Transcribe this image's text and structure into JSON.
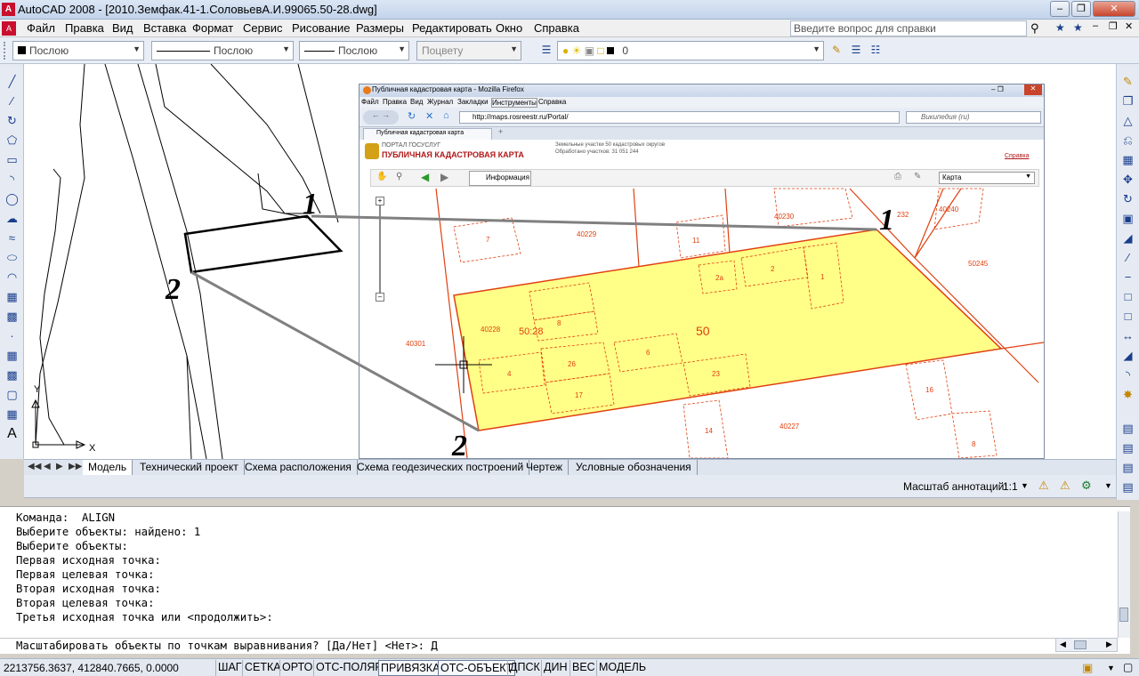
{
  "titlebar": {
    "title": "AutoCAD 2008 - [2010.Земфак.41-1.СоловьевА.И.99065.50-28.dwg]",
    "app_icon": "A"
  },
  "menu": {
    "items": [
      "Файл",
      "Правка",
      "Вид",
      "Вставка",
      "Формат",
      "Сервис",
      "Рисование",
      "Размеры",
      "Редактировать",
      "Окно",
      "Справка"
    ],
    "help_placeholder": "Введите вопрос для справки"
  },
  "toolbar": {
    "color_combo": "Послою",
    "linetype_combo": "Послою",
    "lineweight_combo": "Послою",
    "plotstyle_combo": "Поцвету",
    "layer_combo": "0"
  },
  "drawing": {
    "point_labels": [
      "1",
      "2",
      "1",
      "2"
    ]
  },
  "browser": {
    "title": "Публичная кадастровая карта - Mozilla Firefox",
    "menu": [
      "Файл",
      "Правка",
      "Вид",
      "Журнал",
      "Закладки",
      "Инструменты",
      "Справка"
    ],
    "url": "http://maps.rosreestr.ru/Portal/",
    "search_placeholder": "Википедия (ru)",
    "tab_label": "Публичная кадастровая карта",
    "portal_small": "ПОРТАЛ ГОСУСЛУГ",
    "portal_title": "ПУБЛИЧНАЯ КАДАСТРОВАЯ КАРТА",
    "info_line1": "Земельные участки 50 кадастровых округов",
    "info_line2": "Обработано участков: 31 051 244",
    "help_link": "Справка",
    "info_button": "Информация",
    "map_select": "Карта",
    "parcel_labels": [
      "40229",
      "40230",
      "40240",
      "232",
      "50245",
      "40228",
      "50:28",
      "50",
      "40301",
      "40227",
      "11",
      "2a",
      "2",
      "1",
      "6",
      "26",
      "4",
      "23",
      "17",
      "16",
      "14",
      "8",
      "7",
      "8"
    ]
  },
  "layout_tabs": {
    "tabs": [
      "Модель",
      "Технический проект",
      "Схема расположения",
      "Схема геодезических построений",
      "Чертеж",
      "Условные обозначения"
    ],
    "active": "Модель"
  },
  "annotation": {
    "scale_label": "Масштаб аннотаций:",
    "scale_value": "1:1"
  },
  "command": {
    "lines": [
      "Команда:  ALIGN",
      "Выберите объекты: найдено: 1",
      "Выберите объекты:",
      "Первая исходная точка:",
      "Первая целевая точка:",
      "Вторая исходная точка:",
      "Вторая целевая точка:",
      "Третья исходная точка или <продолжить>:"
    ],
    "prompt": "Масштабировать объекты по точкам выравнивания? [Да/Нет] <Нет>: Д"
  },
  "status": {
    "coords": "2213756.3637, 412840.7665, 0.0000",
    "buttons": [
      "ШАГ",
      "СЕТКА",
      "ОРТО",
      "ОТС-ПОЛЯР",
      "ПРИВЯЗКА",
      "ОТС-ОБЪЕКТ",
      "ДПСК",
      "ДИН",
      "ВЕС",
      "МОДЕЛЬ"
    ]
  },
  "ucs": {
    "y": "Y",
    "x": "X"
  },
  "colors": {
    "parcel_fill": "#ffff88",
    "parcel_border": "#e04010",
    "acad_blue": "#1a3e8c"
  }
}
